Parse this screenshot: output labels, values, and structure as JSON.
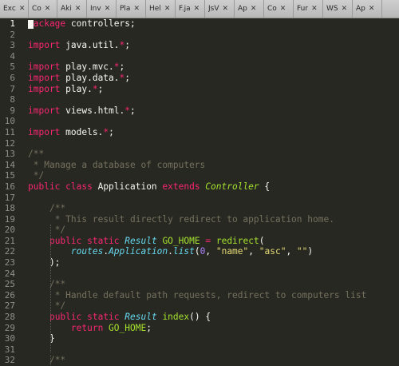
{
  "tabs": [
    {
      "label": "Exc",
      "width": 36
    },
    {
      "label": "Co",
      "width": 36
    },
    {
      "label": "Aki",
      "width": 37
    },
    {
      "label": "Inv",
      "width": 37
    },
    {
      "label": "Pla",
      "width": 37
    },
    {
      "label": "Hel",
      "width": 37
    },
    {
      "label": "F.ja",
      "width": 37
    },
    {
      "label": "JsV",
      "width": 37
    },
    {
      "label": "Ap",
      "width": 37
    },
    {
      "label": "Co",
      "width": 37
    },
    {
      "label": "Fur",
      "width": 37
    },
    {
      "label": "WS",
      "width": 37
    },
    {
      "label": "Ap",
      "width": 37
    }
  ],
  "tab_close_glyph": "✕",
  "current_line": 1,
  "lines": [
    [
      {
        "t": "package ",
        "k": "k"
      },
      {
        "t": "controllers;"
      }
    ],
    [],
    [
      {
        "t": "import ",
        "k": "k"
      },
      {
        "t": "java.util."
      },
      {
        "t": "*",
        "k": "k"
      },
      {
        "t": ";"
      }
    ],
    [],
    [
      {
        "t": "import ",
        "k": "k"
      },
      {
        "t": "play.mvc."
      },
      {
        "t": "*",
        "k": "k"
      },
      {
        "t": ";"
      }
    ],
    [
      {
        "t": "import ",
        "k": "k"
      },
      {
        "t": "play.data."
      },
      {
        "t": "*",
        "k": "k"
      },
      {
        "t": ";"
      }
    ],
    [
      {
        "t": "import ",
        "k": "k"
      },
      {
        "t": "play."
      },
      {
        "t": "*",
        "k": "k"
      },
      {
        "t": ";"
      }
    ],
    [],
    [
      {
        "t": "import ",
        "k": "k"
      },
      {
        "t": "views.html."
      },
      {
        "t": "*",
        "k": "k"
      },
      {
        "t": ";"
      }
    ],
    [],
    [
      {
        "t": "import ",
        "k": "k"
      },
      {
        "t": "models."
      },
      {
        "t": "*",
        "k": "k"
      },
      {
        "t": ";"
      }
    ],
    [],
    [
      {
        "t": "/**",
        "k": "c"
      }
    ],
    [
      {
        "t": " * Manage a database of computers",
        "k": "c"
      }
    ],
    [
      {
        "t": " */",
        "k": "c"
      }
    ],
    [
      {
        "t": "public ",
        "k": "k"
      },
      {
        "t": "class ",
        "k": "k"
      },
      {
        "t": "Application "
      },
      {
        "t": "extends ",
        "k": "k"
      },
      {
        "t": "Controller",
        "k": "g"
      },
      {
        "t": " {"
      }
    ],
    [],
    [
      {
        "t": "    "
      },
      {
        "t": "/**",
        "k": "c"
      }
    ],
    [
      {
        "t": "    "
      },
      {
        "t": " * This result directly redirect to application home.",
        "k": "c"
      }
    ],
    [
      {
        "t": "    "
      },
      {
        "t": " */",
        "k": "c"
      }
    ],
    [
      {
        "t": "    "
      },
      {
        "t": "public ",
        "k": "k"
      },
      {
        "t": "static ",
        "k": "k"
      },
      {
        "t": "Result",
        "k": "t"
      },
      {
        "t": " "
      },
      {
        "t": "GO_HOME",
        "k": "f"
      },
      {
        "t": " "
      },
      {
        "t": "=",
        "k": "k"
      },
      {
        "t": " "
      },
      {
        "t": "redirect",
        "k": "f"
      },
      {
        "t": "("
      }
    ],
    [
      {
        "t": "        "
      },
      {
        "t": "routes",
        "k": "t"
      },
      {
        "t": "."
      },
      {
        "t": "Application",
        "k": "t"
      },
      {
        "t": "."
      },
      {
        "t": "list",
        "k": "t"
      },
      {
        "t": "("
      },
      {
        "t": "0",
        "k": "n"
      },
      {
        "t": ", "
      },
      {
        "t": "\"name\"",
        "k": "s"
      },
      {
        "t": ", "
      },
      {
        "t": "\"asc\"",
        "k": "s"
      },
      {
        "t": ", "
      },
      {
        "t": "\"\"",
        "k": "s"
      },
      {
        "t": ")"
      }
    ],
    [
      {
        "t": "    );"
      }
    ],
    [],
    [
      {
        "t": "    "
      },
      {
        "t": "/**",
        "k": "c"
      }
    ],
    [
      {
        "t": "    "
      },
      {
        "t": " * Handle default path requests, redirect to computers list",
        "k": "c"
      }
    ],
    [
      {
        "t": "    "
      },
      {
        "t": " */",
        "k": "c"
      }
    ],
    [
      {
        "t": "    "
      },
      {
        "t": "public ",
        "k": "k"
      },
      {
        "t": "static ",
        "k": "k"
      },
      {
        "t": "Result",
        "k": "t"
      },
      {
        "t": " "
      },
      {
        "t": "index",
        "k": "f"
      },
      {
        "t": "() {"
      }
    ],
    [
      {
        "t": "        "
      },
      {
        "t": "return ",
        "k": "k"
      },
      {
        "t": "GO_HOME",
        "k": "f"
      },
      {
        "t": ";"
      }
    ],
    [
      {
        "t": "    }"
      }
    ],
    [],
    [
      {
        "t": "    "
      },
      {
        "t": "/**",
        "k": "c"
      }
    ]
  ]
}
